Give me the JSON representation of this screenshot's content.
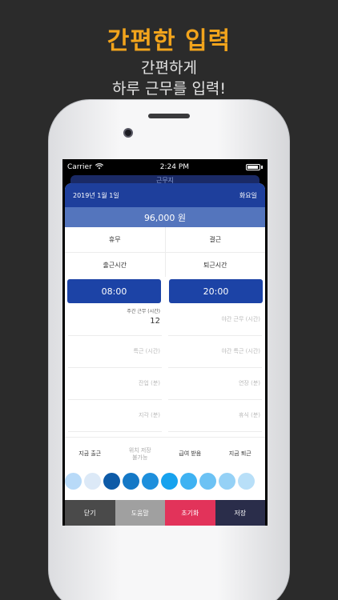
{
  "promo": {
    "headline": "간편한 입력",
    "subline_1": "간편하게",
    "subline_2": "하루 근무를 입력!"
  },
  "status_bar": {
    "carrier": "Carrier",
    "time": "2:24 PM"
  },
  "background_nav": {
    "title": "근무지"
  },
  "sheet": {
    "date": "2019년 1월 1일",
    "weekday": "화요일",
    "wage": "96,000 원",
    "toggles": [
      "휴무",
      "결근"
    ],
    "time_labels": [
      "출근시간",
      "퇴근시간"
    ],
    "start_time": "08:00",
    "end_time": "20:00",
    "fields": {
      "work_hours_label": "주간 근무 (시간)",
      "work_hours_value": "12",
      "night_hours_placeholder": "야간 근무 (시간)",
      "special_hours_placeholder": "특근 (시간)",
      "night_special_placeholder": "야간 특근 (시간)",
      "overtime_placeholder": "잔업 (분)",
      "extension_placeholder": "연장 (분)",
      "late_placeholder": "지각 (분)",
      "break_placeholder": "휴식 (분)"
    },
    "actions": {
      "clock_in_now": "지금 출근",
      "save_location_1": "위치 저장",
      "save_location_2": "불가능",
      "payday": "급여 받음",
      "clock_out_now": "지금 퇴근"
    },
    "swatch_colors": [
      "#b8daf8",
      "#dce9f7",
      "#0d5aa7",
      "#1478c6",
      "#1e8fdc",
      "#17a2ee",
      "#3fb2f2",
      "#6cc2f4",
      "#95d1f6",
      "#b8dff8"
    ]
  },
  "bottom_bar": {
    "close": "닫기",
    "help": "도움말",
    "reset": "초기화",
    "save": "저장",
    "colors": {
      "close": "#4a4a4a",
      "help": "#a0a0a0",
      "reset": "#e2335a",
      "save": "#2a2d4a"
    }
  }
}
